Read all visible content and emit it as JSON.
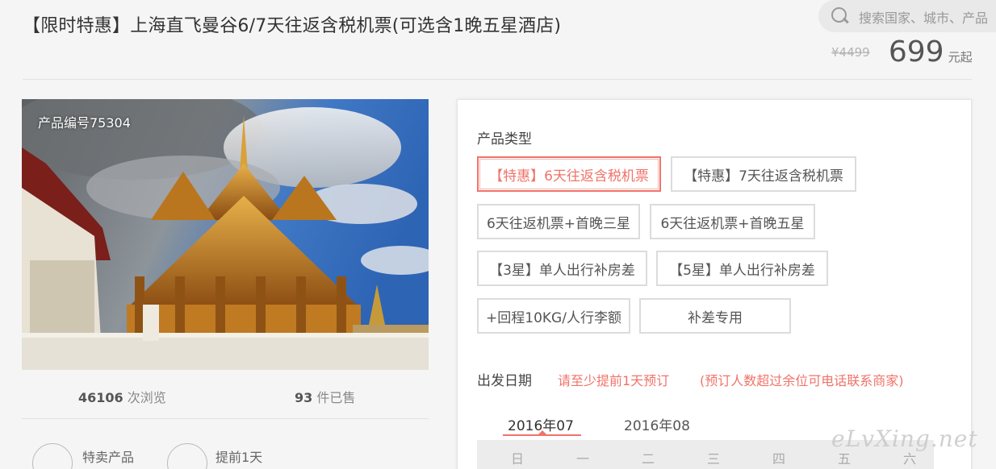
{
  "header": {
    "title": "【限时特惠】上海直飞曼谷6/7天往返含税机票(可选含1晚五星酒店)",
    "search_placeholder": "搜索国家、城市、产品",
    "old_price": "¥4499",
    "price": "699",
    "price_unit": "元起"
  },
  "product": {
    "id_label": "产品编号75304",
    "views_count": "46106",
    "views_label": "次浏览",
    "sold_count": "93",
    "sold_label": "件已售",
    "features": [
      {
        "label": "特卖产品",
        "icon": "tag-icon"
      },
      {
        "label": "提前1天",
        "icon": "clock-icon"
      }
    ]
  },
  "options": {
    "title": "产品类型",
    "items": [
      {
        "label": "【特惠】6天往返含税机票",
        "selected": true
      },
      {
        "label": "【特惠】7天往返含税机票",
        "selected": false
      },
      {
        "label": "6天往返机票+首晚三星",
        "selected": false
      },
      {
        "label": "6天往返机票+首晚五星",
        "selected": false
      },
      {
        "label": "【3星】单人出行补房差",
        "selected": false
      },
      {
        "label": "【5星】单人出行补房差",
        "selected": false
      },
      {
        "label": "+回程10KG/人行李额",
        "selected": false
      },
      {
        "label": "补差专用",
        "selected": false
      }
    ]
  },
  "departure": {
    "title": "出发日期",
    "notice1": "请至少提前1天预订",
    "notice2": "(预订人数超过余位可电话联系商家)",
    "months": [
      "2016年07",
      "2016年08"
    ],
    "active_month": "2016年07",
    "weekdays": [
      "日",
      "一",
      "二",
      "三",
      "四",
      "五",
      "六"
    ]
  },
  "watermark": "eLvXing.net",
  "colors": {
    "accent": "#f0736a",
    "text": "#333333",
    "muted": "#888888"
  }
}
